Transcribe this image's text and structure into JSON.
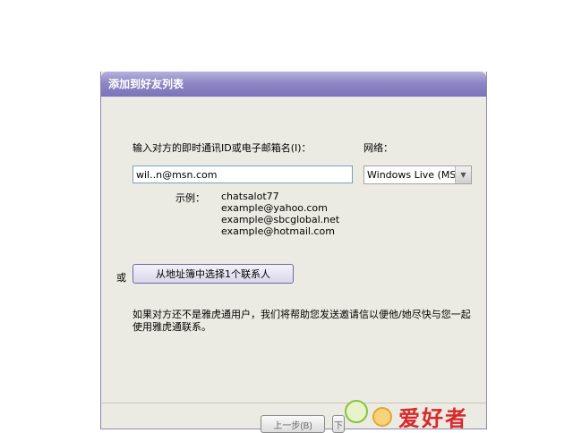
{
  "window": {
    "title": "添加到好友列表"
  },
  "form": {
    "id_label": "输入对方的即时通讯ID或电子邮箱名(I)：",
    "id_value": "wil..n@msn.com",
    "network_label": "网络：",
    "network_value": "Windows Live (MSN)",
    "examples_label": "示例：",
    "examples": [
      "chatsalot77",
      "example@yahoo.com",
      "example@sbcglobal.net",
      "example@hotmail.com"
    ],
    "or_label": "或",
    "addressbook_button": "从地址簿中选择1个联系人",
    "note": "如果对方还不是雅虎通用户，我们将帮助您发送邀请信以便他/她尽快与您一起使用雅虎通联系。"
  },
  "buttons": {
    "back": "上一步(B)",
    "next": "下"
  },
  "watermark": {
    "text": "爱好者"
  },
  "colors": {
    "titlebar": "#8e87c5",
    "dialog_bg": "#ecebe3",
    "watermark": "#d9292b"
  }
}
